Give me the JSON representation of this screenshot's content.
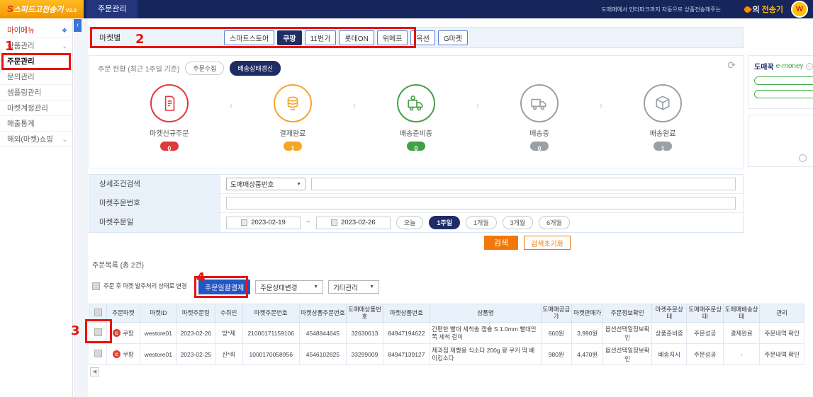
{
  "icons": {
    "collapse": "‹",
    "chevron_down": "⌄",
    "select_arrow": "▼",
    "refresh": "⟳",
    "info": "i",
    "step_arrow": "›",
    "scroll_left": "◀",
    "tilde": "~",
    "badge_letter": "W",
    "coupang_c": "c",
    "my_menu_star": "❖"
  },
  "topbar": {
    "logo_s": "S",
    "logo_text": "스피드고전송기",
    "version": "V2.0",
    "tab": "주문관리",
    "promo": "도매매에서 인터파크까지 자동으로 상품전송해주는",
    "brand_prefix": "의",
    "brand_name": "전송기"
  },
  "sidebar": {
    "items": [
      {
        "label": "마이메뉴"
      },
      {
        "label": "상품관리"
      },
      {
        "label": "주문관리"
      },
      {
        "label": "문의관리"
      },
      {
        "label": "샘플링관리"
      },
      {
        "label": "마켓계정관리"
      },
      {
        "label": "매출통계"
      },
      {
        "label": "해외(마켓)쇼핑"
      }
    ]
  },
  "market_filter": {
    "label": "마켓별",
    "tabs": [
      "스마트스토어",
      "쿠팡",
      "11번가",
      "롯데ON",
      "위메프",
      "옥션",
      "G마켓"
    ]
  },
  "order_status": {
    "title": "주문 현황 (최근 1주일 기준)",
    "collect_button": "주문수집",
    "refresh_button": "배송상태갱신",
    "steps": [
      {
        "label": "마켓신규주문",
        "count": "0",
        "color": "#e0393b"
      },
      {
        "label": "결제완료",
        "count": "1",
        "color": "#f5a623"
      },
      {
        "label": "배송준비중",
        "count": "0",
        "color": "#43a047"
      },
      {
        "label": "배송중",
        "count": "0",
        "color": "#9aa0a6"
      },
      {
        "label": "배송완료",
        "count": "1",
        "color": "#9aa0a6"
      }
    ]
  },
  "emoney": {
    "brand": "도매꾹",
    "label": "e-money"
  },
  "search": {
    "row1_label": "상세조건검색",
    "type_select": "도매매상품번호",
    "row2_label": "마켓주문번호",
    "row3_label": "마켓주문일",
    "date_from": "2023-02-19",
    "date_to": "2023-02-26",
    "ranges": [
      "오늘",
      "1주일",
      "1개월",
      "3개월",
      "6개월"
    ],
    "search_button": "검색",
    "reset_button": "검색초기화"
  },
  "order_list": {
    "title": "주문목록 (총 2건)",
    "checkbox_label": "주문 후 마켓 발주처리 상태로 변경",
    "bulk_pay_button": "주문일괄결제",
    "status_select": "주문상태변경",
    "etc_select": "기타관리",
    "columns": [
      "주문마켓",
      "마켓ID",
      "마켓주문일",
      "수취인",
      "마켓주문번호",
      "마켓상품주문번호",
      "도매매상품번호",
      "마켓상품번호",
      "상품명",
      "도매매공급가",
      "마켓판매가",
      "주문정보확인",
      "마켓주문상태",
      "도매매주문상태",
      "도매매배송상태",
      "관리"
    ],
    "rows": [
      {
        "market": "쿠팡",
        "market_id": "westore01",
        "order_date": "2023-02-26",
        "receiver": "방*제",
        "order_no": "21000171159106",
        "item_order_no": "4548844645",
        "domeme_no": "32630613",
        "market_item_no": "84947194622",
        "product": "간편한 빨대 세척솔 캡슐 S 1.0mm 빨대안쪽 세척 걸이",
        "supply_price": "660원",
        "market_price": "3,990원",
        "info_check": "옵션선택일정보확인",
        "market_status": "상품준비중",
        "domeme_order_status": "주문성공",
        "domeme_ship_status": "결제완료",
        "manage": "주문내역 확인"
      },
      {
        "market": "쿠팡",
        "market_id": "westore01",
        "order_date": "2023-02-25",
        "receiver": "신*희",
        "order_no": "1000170058956",
        "item_order_no": "4546102825",
        "domeme_no": "33299009",
        "market_item_no": "84947139127",
        "product": "제과점 제빵용 식소다 200g 왕 쿠키 떡 베이킹소다",
        "supply_price": "980원",
        "market_price": "4,470원",
        "info_check": "옵션선택일정보확인",
        "market_status": "배송지시",
        "domeme_order_status": "주문성공",
        "domeme_ship_status": "-",
        "manage": "주문내역 확인"
      }
    ]
  },
  "annotations": {
    "n1": "1",
    "n2": "2",
    "n3": "3",
    "n4": "4"
  }
}
